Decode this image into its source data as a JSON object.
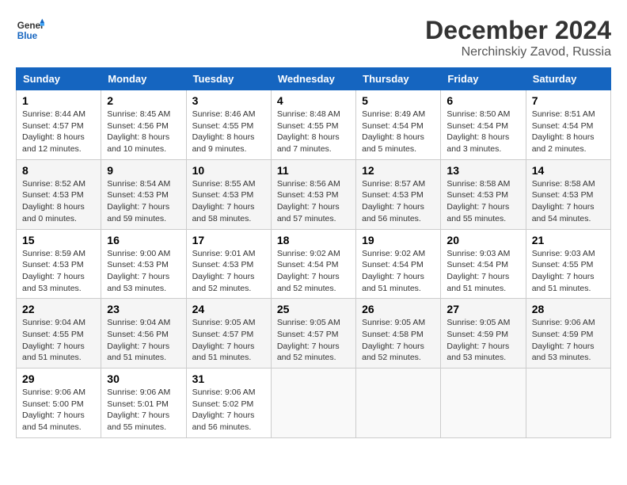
{
  "header": {
    "logo_line1": "General",
    "logo_line2": "Blue",
    "main_title": "December 2024",
    "subtitle": "Nerchinskиy Zavod, Russia"
  },
  "days_of_week": [
    "Sunday",
    "Monday",
    "Tuesday",
    "Wednesday",
    "Thursday",
    "Friday",
    "Saturday"
  ],
  "weeks": [
    [
      {
        "day": "1",
        "info": "Sunrise: 8:44 AM\nSunset: 4:57 PM\nDaylight: 8 hours\nand 12 minutes."
      },
      {
        "day": "2",
        "info": "Sunrise: 8:45 AM\nSunset: 4:56 PM\nDaylight: 8 hours\nand 10 minutes."
      },
      {
        "day": "3",
        "info": "Sunrise: 8:46 AM\nSunset: 4:55 PM\nDaylight: 8 hours\nand 9 minutes."
      },
      {
        "day": "4",
        "info": "Sunrise: 8:48 AM\nSunset: 4:55 PM\nDaylight: 8 hours\nand 7 minutes."
      },
      {
        "day": "5",
        "info": "Sunrise: 8:49 AM\nSunset: 4:54 PM\nDaylight: 8 hours\nand 5 minutes."
      },
      {
        "day": "6",
        "info": "Sunrise: 8:50 AM\nSunset: 4:54 PM\nDaylight: 8 hours\nand 3 minutes."
      },
      {
        "day": "7",
        "info": "Sunrise: 8:51 AM\nSunset: 4:54 PM\nDaylight: 8 hours\nand 2 minutes."
      }
    ],
    [
      {
        "day": "8",
        "info": "Sunrise: 8:52 AM\nSunset: 4:53 PM\nDaylight: 8 hours\nand 0 minutes."
      },
      {
        "day": "9",
        "info": "Sunrise: 8:54 AM\nSunset: 4:53 PM\nDaylight: 7 hours\nand 59 minutes."
      },
      {
        "day": "10",
        "info": "Sunrise: 8:55 AM\nSunset: 4:53 PM\nDaylight: 7 hours\nand 58 minutes."
      },
      {
        "day": "11",
        "info": "Sunrise: 8:56 AM\nSunset: 4:53 PM\nDaylight: 7 hours\nand 57 minutes."
      },
      {
        "day": "12",
        "info": "Sunrise: 8:57 AM\nSunset: 4:53 PM\nDaylight: 7 hours\nand 56 minutes."
      },
      {
        "day": "13",
        "info": "Sunrise: 8:58 AM\nSunset: 4:53 PM\nDaylight: 7 hours\nand 55 minutes."
      },
      {
        "day": "14",
        "info": "Sunrise: 8:58 AM\nSunset: 4:53 PM\nDaylight: 7 hours\nand 54 minutes."
      }
    ],
    [
      {
        "day": "15",
        "info": "Sunrise: 8:59 AM\nSunset: 4:53 PM\nDaylight: 7 hours\nand 53 minutes."
      },
      {
        "day": "16",
        "info": "Sunrise: 9:00 AM\nSunset: 4:53 PM\nDaylight: 7 hours\nand 53 minutes."
      },
      {
        "day": "17",
        "info": "Sunrise: 9:01 AM\nSunset: 4:53 PM\nDaylight: 7 hours\nand 52 minutes."
      },
      {
        "day": "18",
        "info": "Sunrise: 9:02 AM\nSunset: 4:54 PM\nDaylight: 7 hours\nand 52 minutes."
      },
      {
        "day": "19",
        "info": "Sunrise: 9:02 AM\nSunset: 4:54 PM\nDaylight: 7 hours\nand 51 minutes."
      },
      {
        "day": "20",
        "info": "Sunrise: 9:03 AM\nSunset: 4:54 PM\nDaylight: 7 hours\nand 51 minutes."
      },
      {
        "day": "21",
        "info": "Sunrise: 9:03 AM\nSunset: 4:55 PM\nDaylight: 7 hours\nand 51 minutes."
      }
    ],
    [
      {
        "day": "22",
        "info": "Sunrise: 9:04 AM\nSunset: 4:55 PM\nDaylight: 7 hours\nand 51 minutes."
      },
      {
        "day": "23",
        "info": "Sunrise: 9:04 AM\nSunset: 4:56 PM\nDaylight: 7 hours\nand 51 minutes."
      },
      {
        "day": "24",
        "info": "Sunrise: 9:05 AM\nSunset: 4:57 PM\nDaylight: 7 hours\nand 51 minutes."
      },
      {
        "day": "25",
        "info": "Sunrise: 9:05 AM\nSunset: 4:57 PM\nDaylight: 7 hours\nand 52 minutes."
      },
      {
        "day": "26",
        "info": "Sunrise: 9:05 AM\nSunset: 4:58 PM\nDaylight: 7 hours\nand 52 minutes."
      },
      {
        "day": "27",
        "info": "Sunrise: 9:05 AM\nSunset: 4:59 PM\nDaylight: 7 hours\nand 53 minutes."
      },
      {
        "day": "28",
        "info": "Sunrise: 9:06 AM\nSunset: 4:59 PM\nDaylight: 7 hours\nand 53 minutes."
      }
    ],
    [
      {
        "day": "29",
        "info": "Sunrise: 9:06 AM\nSunset: 5:00 PM\nDaylight: 7 hours\nand 54 minutes."
      },
      {
        "day": "30",
        "info": "Sunrise: 9:06 AM\nSunset: 5:01 PM\nDaylight: 7 hours\nand 55 minutes."
      },
      {
        "day": "31",
        "info": "Sunrise: 9:06 AM\nSunset: 5:02 PM\nDaylight: 7 hours\nand 56 minutes."
      },
      null,
      null,
      null,
      null
    ]
  ]
}
